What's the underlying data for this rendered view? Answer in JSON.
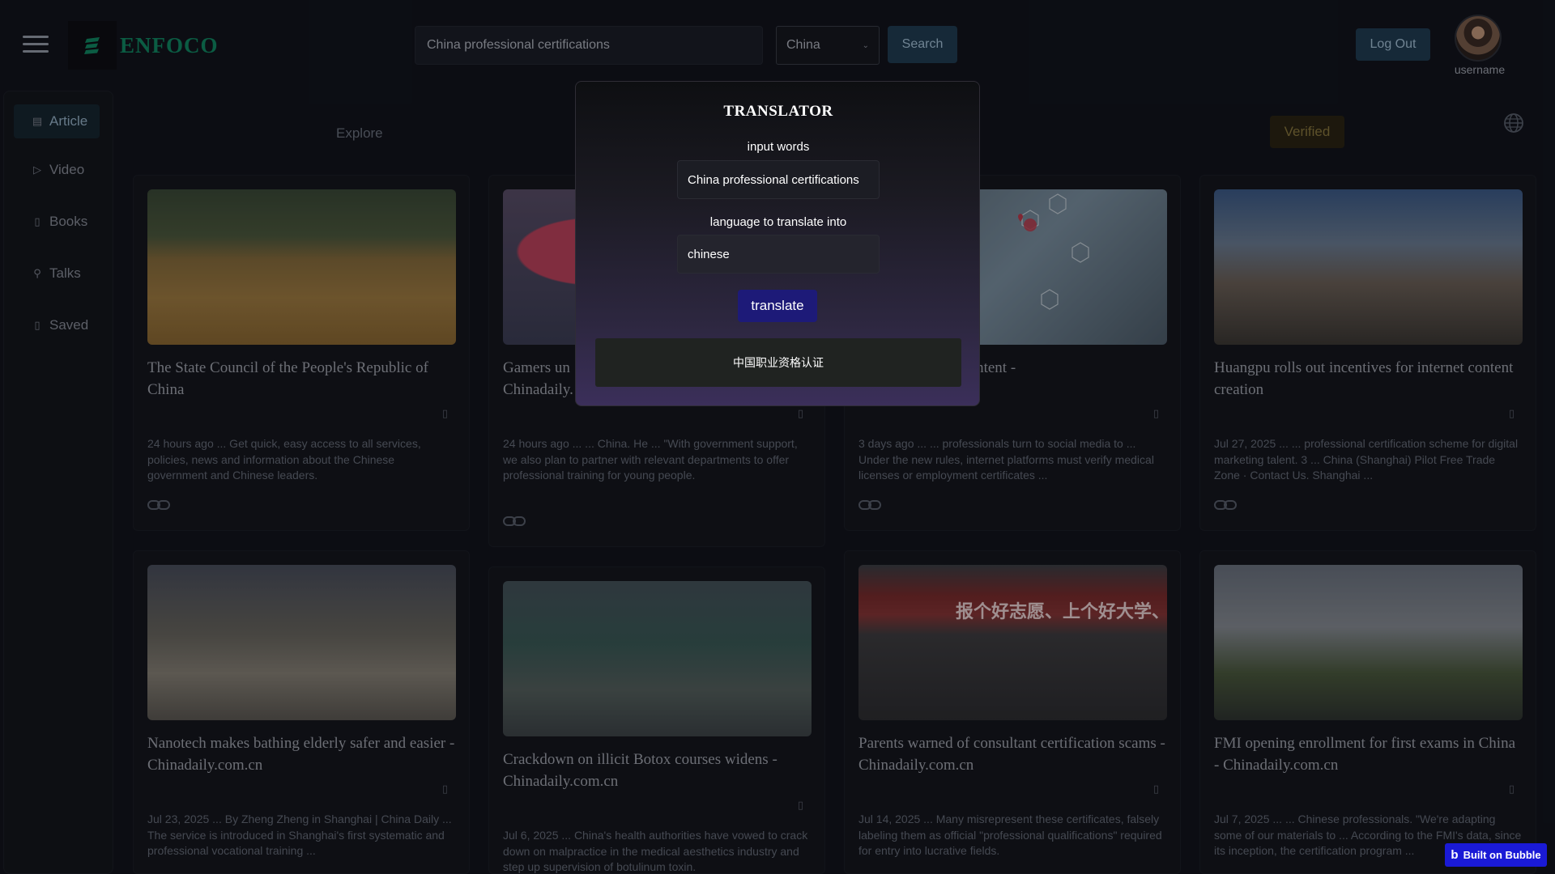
{
  "header": {
    "logo_text": "ENFOCO",
    "search_value": "China professional certifications",
    "country": "China",
    "search_label": "Search",
    "logout_label": "Log Out",
    "username": "username"
  },
  "sidebar": {
    "items": [
      {
        "label": "Article",
        "icon": "document-icon",
        "active": true
      },
      {
        "label": "Video",
        "icon": "play-icon"
      },
      {
        "label": "Books",
        "icon": "book-icon"
      },
      {
        "label": "Talks",
        "icon": "microphone-icon"
      },
      {
        "label": "Saved",
        "icon": "bookmark-icon"
      }
    ]
  },
  "tabs": {
    "explore": "Explore",
    "verified": "Verified"
  },
  "cards": [
    {
      "title": "The State Council of the People's Republic of China",
      "desc": "24 hours ago ... Get quick, easy access to all services, policies, news and information about the Chinese government and Chinese leaders."
    },
    {
      "title": "Gamers un... Chinadaily...",
      "title_line1": "Gamers un",
      "title_line2": "Chinadaily.",
      "desc": "24 hours ago ... ... China. He ... \"With government support, we also plan to partner with relevant departments to offer professional training for young people."
    },
    {
      "title_line1": "up online health content -",
      "desc": "3 days ago ... ... professionals turn to social media to ... Under the new rules, internet platforms must verify medical licenses or employment certificates ..."
    },
    {
      "title": "Huangpu rolls out incentives for internet content creation",
      "desc": "Jul 27, 2025 ... ... professional certification scheme for digital marketing talent. 3 ... China (Shanghai) Pilot Free Trade Zone · Contact Us. Shanghai ..."
    },
    {
      "title": "Nanotech makes bathing elderly safer and easier - Chinadaily.com.cn",
      "desc": "Jul 23, 2025 ... By Zheng Zheng in Shanghai | China Daily ... The service is introduced in Shanghai's first systematic and professional vocational training ..."
    },
    {
      "title": "Crackdown on illicit Botox courses widens - Chinadaily.com.cn",
      "desc": "Jul 6, 2025 ... China's health authorities have vowed to crack down on malpractice in the medical aesthetics industry and step up supervision of botulinum toxin."
    },
    {
      "title": "Parents warned of consultant certification scams - Chinadaily.com.cn",
      "desc": "Jul 14, 2025 ... Many misrepresent these certificates, falsely labeling them as official \"professional qualifications\" required for entry into lucrative fields."
    },
    {
      "title": "FMI opening enrollment for first exams in China - Chinadaily.com.cn",
      "desc": "Jul 7, 2025 ... ... Chinese professionals. \"We're adapting some of our materials to ... According to the FMI's data, since its inception, the certification program ..."
    }
  ],
  "image_banner_text": "报个好志愿、上个好大学、大",
  "translator": {
    "title": "TRANSLATOR",
    "input_label": "input words",
    "input_value": "China professional certifications",
    "lang_label": "language to translate into",
    "lang_value": "chinese",
    "button": "translate",
    "result": "中国职业资格认证"
  },
  "badge": "Built on Bubble"
}
